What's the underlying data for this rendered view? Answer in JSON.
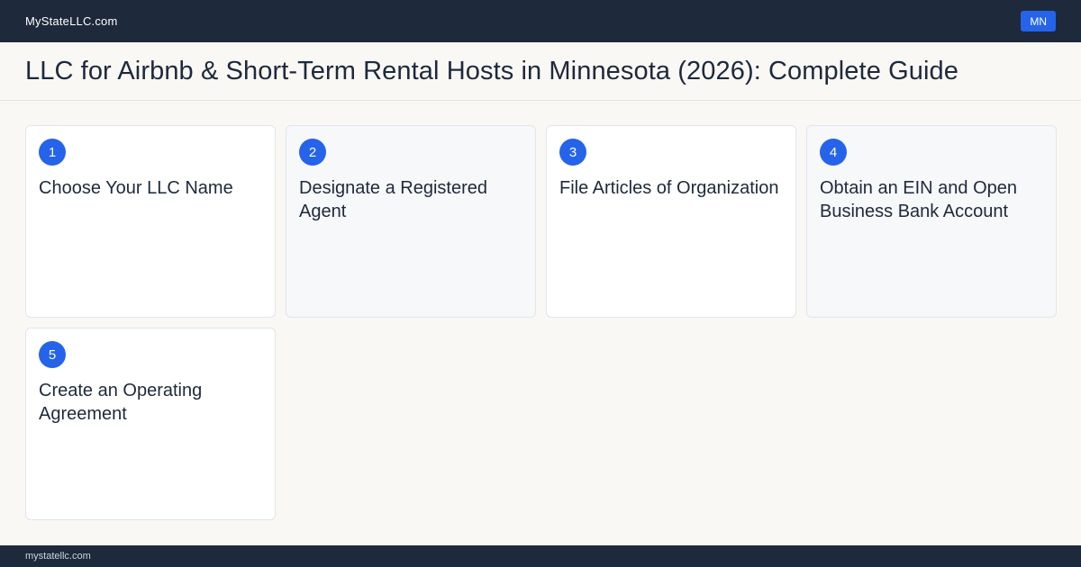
{
  "header": {
    "brand": "MyStateLLC.com",
    "state_badge": "MN"
  },
  "page": {
    "title": "LLC for Airbnb & Short-Term  Rental Hosts in Minnesota (2026): Complete Guide"
  },
  "steps": [
    {
      "number": "1",
      "title": "Choose Your LLC Name"
    },
    {
      "number": "2",
      "title": "Designate a Registered Agent"
    },
    {
      "number": "3",
      "title": "File Articles of Organization"
    },
    {
      "number": "4",
      "title": "Obtain an EIN and Open Business Bank Account"
    },
    {
      "number": "5",
      "title": "Create an Operating Agreement"
    }
  ],
  "footer": {
    "domain": "mystatellc.com"
  },
  "colors": {
    "navy": "#1e293b",
    "accent": "#2563eb",
    "background": "#f9f8f5"
  }
}
